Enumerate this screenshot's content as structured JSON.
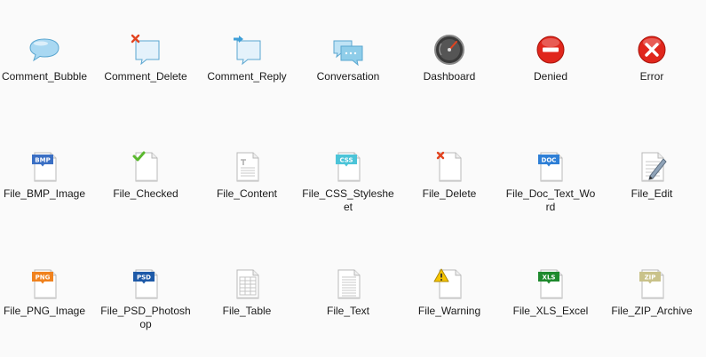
{
  "icons": [
    {
      "label": "Comment_Bubble",
      "icon": "comment-bubble-icon"
    },
    {
      "label": "Comment_Delete",
      "icon": "comment-delete-icon"
    },
    {
      "label": "Comment_Reply",
      "icon": "comment-reply-icon"
    },
    {
      "label": "Conversation",
      "icon": "conversation-icon"
    },
    {
      "label": "Dashboard",
      "icon": "dashboard-icon"
    },
    {
      "label": "Denied",
      "icon": "denied-icon"
    },
    {
      "label": "Error",
      "icon": "error-icon"
    },
    {
      "label": "File_BMP_Image",
      "icon": "file-bmp-image-icon",
      "badge": "BMP"
    },
    {
      "label": "File_Checked",
      "icon": "file-checked-icon"
    },
    {
      "label": "File_Content",
      "icon": "file-content-icon"
    },
    {
      "label": "File_CSS_Stylesheet",
      "icon": "file-css-stylesheet-icon",
      "badge": "CSS"
    },
    {
      "label": "File_Delete",
      "icon": "file-delete-icon"
    },
    {
      "label": "File_Doc_Text_Word",
      "icon": "file-doc-text-word-icon",
      "badge": "DOC"
    },
    {
      "label": "File_Edit",
      "icon": "file-edit-icon"
    },
    {
      "label": "File_PNG_Image",
      "icon": "file-png-image-icon",
      "badge": "PNG"
    },
    {
      "label": "File_PSD_Photoshop",
      "icon": "file-psd-photoshop-icon",
      "badge": "PSD"
    },
    {
      "label": "File_Table",
      "icon": "file-table-icon"
    },
    {
      "label": "File_Text",
      "icon": "file-text-icon"
    },
    {
      "label": "File_Warning",
      "icon": "file-warning-icon"
    },
    {
      "label": "File_XLS_Excel",
      "icon": "file-xls-excel-icon",
      "badge": "XLS"
    },
    {
      "label": "File_ZIP_Archive",
      "icon": "file-zip-archive-icon",
      "badge": "ZIP"
    }
  ],
  "colors": {
    "bubble": "#a9d8f2",
    "bubble_stroke": "#5aa6d0",
    "badge_bmp": "#3a6fc4",
    "badge_css": "#4cc4d8",
    "badge_doc": "#2e7fd6",
    "badge_png": "#f0821e",
    "badge_psd": "#1e5aa8",
    "badge_xls": "#1f8a2e",
    "badge_zip": "#c9c28a",
    "delete_red": "#e2431f",
    "check_green": "#5ab82e",
    "warning_yellow": "#f5c400"
  }
}
